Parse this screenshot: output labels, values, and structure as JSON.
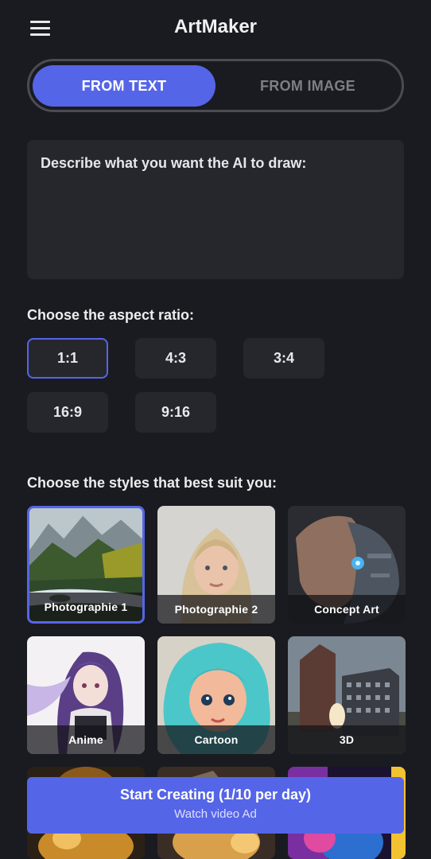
{
  "app": {
    "title": "ArtMaker"
  },
  "header": {
    "menu_icon": "hamburger-menu-icon"
  },
  "mode_tabs": {
    "active": "FROM TEXT",
    "inactive": "FROM IMAGE"
  },
  "prompt": {
    "placeholder": "Describe what you want the AI to draw:"
  },
  "aspect": {
    "label": "Choose the aspect ratio:",
    "options": [
      "1:1",
      "4:3",
      "3:4",
      "16:9",
      "9:16"
    ],
    "selected": "1:1"
  },
  "styles": {
    "label": "Choose the styles that best suit you:",
    "items": [
      "Photographie 1",
      "Photographie 2",
      "Concept Art",
      "Anime",
      "Cartoon",
      "3D"
    ],
    "selected": "Photographie 1"
  },
  "cta": {
    "title": "Start Creating (1/10 per day)",
    "subtitle": "Watch video Ad"
  },
  "colors": {
    "background": "#1a1b20",
    "surface": "#25272d",
    "accent": "#5565e8"
  }
}
